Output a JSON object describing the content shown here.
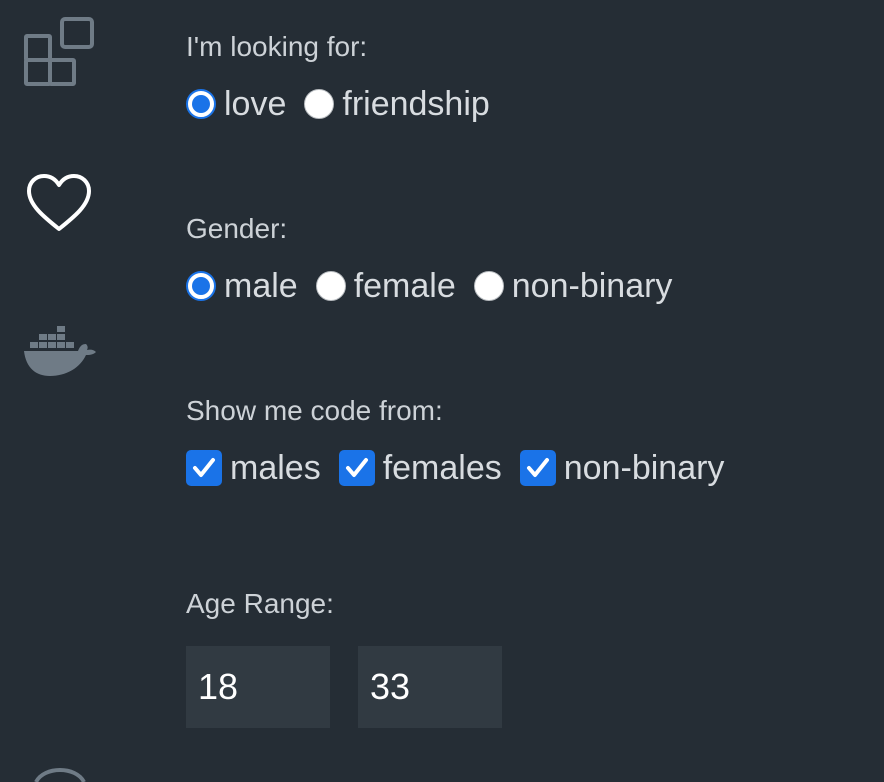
{
  "activity_bar": {
    "icons": [
      "extensions-icon",
      "heart-icon",
      "docker-icon",
      "partial-icon"
    ]
  },
  "looking_for": {
    "label": "I'm looking for:",
    "options": [
      "love",
      "friendship"
    ],
    "selected": "love"
  },
  "gender": {
    "label": "Gender:",
    "options": [
      "male",
      "female",
      "non-binary"
    ],
    "selected": "male"
  },
  "show_code_from": {
    "label": "Show me code from:",
    "options": [
      "males",
      "females",
      "non-binary"
    ],
    "checked": [
      true,
      true,
      true
    ]
  },
  "age_range": {
    "label": "Age Range:",
    "min": "18",
    "max": "33"
  },
  "colors": {
    "background": "#252d35",
    "accent": "#1a73e8",
    "input_bg": "#313a42"
  }
}
